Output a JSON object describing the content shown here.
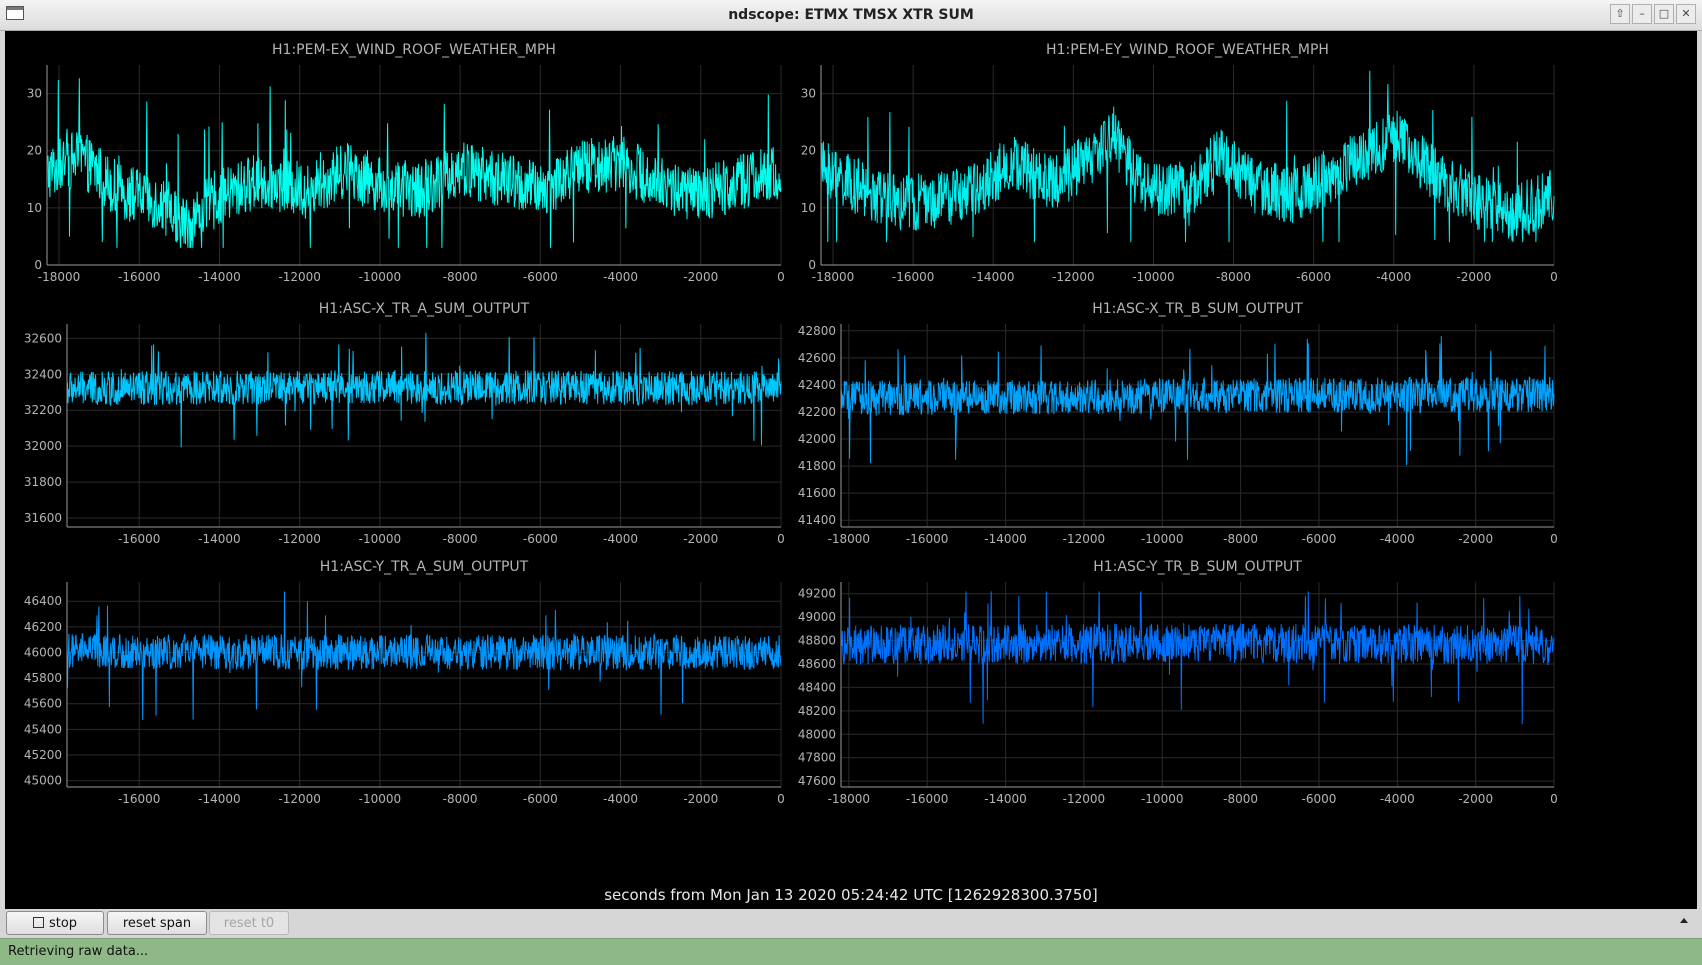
{
  "window": {
    "title": "ndscope: ETMX TMSX XTR SUM",
    "controls": [
      "up-arrow-icon",
      "minimize-icon",
      "maximize-icon",
      "close-icon"
    ]
  },
  "time_axis_label": "seconds from Mon Jan 13 2020 05:24:42 UTC [1262928300.3750]",
  "toolbar": {
    "stop_label": "stop",
    "reset_span_label": "reset span",
    "reset_t0_label": "reset t0"
  },
  "status": "Retrieving raw data...",
  "chart_data": [
    {
      "type": "line",
      "title": "H1:PEM-EX_WIND_ROOF_WEATHER_MPH",
      "color": "#00ffee",
      "xlim": [
        -18300,
        0
      ],
      "ylim": [
        0,
        35
      ],
      "xticks": [
        -18000,
        -16000,
        -14000,
        -12000,
        -10000,
        -8000,
        -6000,
        -4000,
        -2000,
        0
      ],
      "yticks": [
        0,
        10,
        20,
        30
      ],
      "trend": [
        [
          -18300,
          16
        ],
        [
          -17500,
          19
        ],
        [
          -16500,
          13
        ],
        [
          -15500,
          11
        ],
        [
          -14800,
          7
        ],
        [
          -14200,
          11
        ],
        [
          -13000,
          15
        ],
        [
          -11800,
          13
        ],
        [
          -10800,
          17
        ],
        [
          -10000,
          14
        ],
        [
          -9000,
          13
        ],
        [
          -8000,
          17
        ],
        [
          -7000,
          15
        ],
        [
          -6000,
          13
        ],
        [
          -5000,
          17
        ],
        [
          -4000,
          18
        ],
        [
          -3000,
          14
        ],
        [
          -2000,
          12
        ],
        [
          -1000,
          15
        ],
        [
          0,
          16
        ]
      ],
      "band_halfwidth": 5,
      "range_min": 3,
      "range_max": 33
    },
    {
      "type": "line",
      "title": "H1:PEM-EY_WIND_ROOF_WEATHER_MPH",
      "color": "#00f0f0",
      "xlim": [
        -18300,
        0
      ],
      "ylim": [
        0,
        35
      ],
      "xticks": [
        -18000,
        -16000,
        -14000,
        -12000,
        -10000,
        -8000,
        -6000,
        -4000,
        -2000,
        0
      ],
      "yticks": [
        0,
        10,
        20,
        30
      ],
      "trend": [
        [
          -18300,
          17
        ],
        [
          -17500,
          14
        ],
        [
          -16500,
          11
        ],
        [
          -15500,
          11
        ],
        [
          -14500,
          13
        ],
        [
          -13500,
          18
        ],
        [
          -12500,
          14
        ],
        [
          -11500,
          19
        ],
        [
          -11000,
          23
        ],
        [
          -10500,
          16
        ],
        [
          -10000,
          13
        ],
        [
          -9000,
          13
        ],
        [
          -8300,
          20
        ],
        [
          -7500,
          14
        ],
        [
          -6500,
          12
        ],
        [
          -5500,
          16
        ],
        [
          -4500,
          20
        ],
        [
          -4000,
          23
        ],
        [
          -3000,
          16
        ],
        [
          -2000,
          11
        ],
        [
          -1000,
          9
        ],
        [
          0,
          12
        ]
      ],
      "band_halfwidth": 5,
      "range_min": 4,
      "range_max": 34
    },
    {
      "type": "line",
      "title": "H1:ASC-X_TR_A_SUM_OUTPUT",
      "color": "#00c8ff",
      "xlim": [
        -17800,
        0
      ],
      "ylim": [
        31550,
        32680
      ],
      "xticks": [
        -16000,
        -14000,
        -12000,
        -10000,
        -8000,
        -6000,
        -4000,
        -2000,
        0
      ],
      "yticks": [
        31600,
        31800,
        32000,
        32200,
        32400,
        32600
      ],
      "trend": [
        [
          -17800,
          32320
        ],
        [
          -9000,
          32330
        ],
        [
          0,
          32320
        ]
      ],
      "band_halfwidth": 95,
      "range_min": 31700,
      "range_max": 32650
    },
    {
      "type": "line",
      "title": "H1:ASC-X_TR_B_SUM_OUTPUT",
      "color": "#00a4ff",
      "xlim": [
        -18200,
        0
      ],
      "ylim": [
        41350,
        42850
      ],
      "xticks": [
        -18000,
        -16000,
        -14000,
        -12000,
        -10000,
        -8000,
        -6000,
        -4000,
        -2000,
        0
      ],
      "yticks": [
        41400,
        41600,
        41800,
        42000,
        42200,
        42400,
        42600,
        42800
      ],
      "trend": [
        [
          -18200,
          42300
        ],
        [
          -9000,
          42320
        ],
        [
          0,
          42330
        ]
      ],
      "band_halfwidth": 130,
      "range_min": 41440,
      "range_max": 42800
    },
    {
      "type": "line",
      "title": "H1:ASC-Y_TR_A_SUM_OUTPUT",
      "color": "#0096ff",
      "xlim": [
        -17800,
        0
      ],
      "ylim": [
        44950,
        46550
      ],
      "xticks": [
        -16000,
        -14000,
        -12000,
        -10000,
        -8000,
        -6000,
        -4000,
        -2000,
        0
      ],
      "yticks": [
        45000,
        45200,
        45400,
        45600,
        45800,
        46000,
        46200,
        46400
      ],
      "trend": [
        [
          -17800,
          46010
        ],
        [
          -9000,
          46000
        ],
        [
          0,
          46000
        ]
      ],
      "band_halfwidth": 140,
      "range_min": 45150,
      "range_max": 46500
    },
    {
      "type": "line",
      "title": "H1:ASC-Y_TR_B_SUM_OUTPUT",
      "color": "#0070ff",
      "xlim": [
        -18200,
        0
      ],
      "ylim": [
        47550,
        49300
      ],
      "xticks": [
        -18000,
        -16000,
        -14000,
        -12000,
        -10000,
        -8000,
        -6000,
        -4000,
        -2000,
        0
      ],
      "yticks": [
        47600,
        47800,
        48000,
        48200,
        48400,
        48600,
        48800,
        49000,
        49200
      ],
      "trend": [
        [
          -18200,
          48760
        ],
        [
          -9000,
          48780
        ],
        [
          0,
          48760
        ]
      ],
      "band_halfwidth": 170,
      "range_min": 47620,
      "range_max": 49220
    }
  ]
}
